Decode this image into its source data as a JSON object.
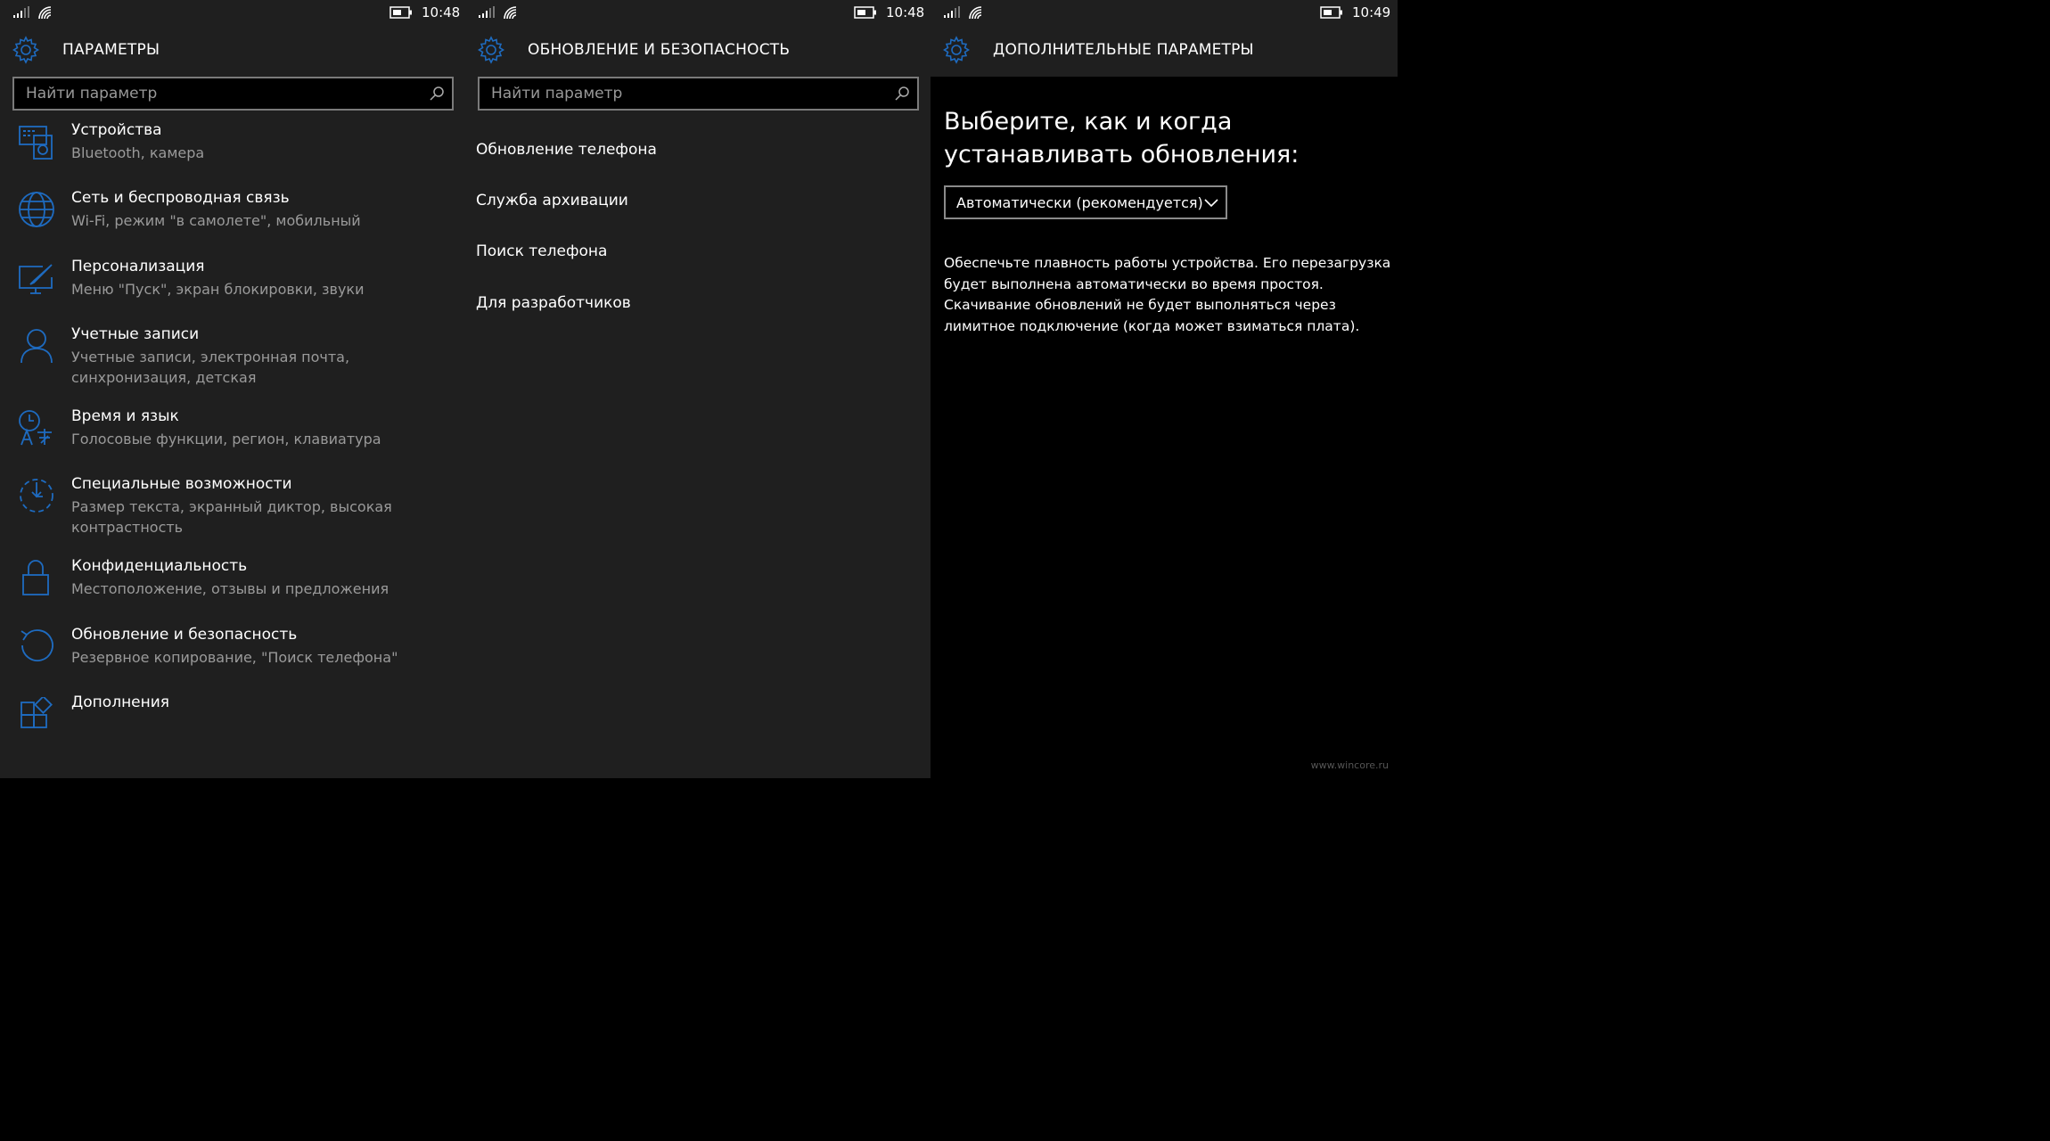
{
  "colors": {
    "accent": "#1e6bc0",
    "panel_bg": "#1f1f1f",
    "black": "#000000",
    "secondary_text": "#9a9a9a"
  },
  "status_bars": [
    {
      "time": "10:48"
    },
    {
      "time": "10:48"
    },
    {
      "time": "10:49"
    }
  ],
  "screen1": {
    "title": "ПАРАМЕТРЫ",
    "search_placeholder": "Найти параметр",
    "items": [
      {
        "icon": "devices-icon",
        "title": "Устройства",
        "subtitle": "Bluetooth, камера"
      },
      {
        "icon": "globe-icon",
        "title": "Сеть и беспроводная связь",
        "subtitle": "Wi-Fi, режим \"в самолете\", мобильный"
      },
      {
        "icon": "personalization-icon",
        "title": "Персонализация",
        "subtitle": "Меню \"Пуск\", экран блокировки, звуки"
      },
      {
        "icon": "person-icon",
        "title": "Учетные записи",
        "subtitle": "Учетные записи, электронная почта, синхронизация, детская"
      },
      {
        "icon": "time-language-icon",
        "title": "Время и язык",
        "subtitle": "Голосовые функции, регион, клавиатура"
      },
      {
        "icon": "accessibility-icon",
        "title": "Специальные возможности",
        "subtitle": "Размер текста, экранный диктор, высокая контрастность"
      },
      {
        "icon": "lock-icon",
        "title": "Конфиденциальность",
        "subtitle": "Местоположение, отзывы и предложения"
      },
      {
        "icon": "update-icon",
        "title": "Обновление и безопасность",
        "subtitle": "Резервное копирование, \"Поиск телефона\""
      },
      {
        "icon": "extras-icon",
        "title": "Дополнения",
        "subtitle": ""
      }
    ]
  },
  "screen2": {
    "title": "ОБНОВЛЕНИЕ И БЕЗОПАСНОСТЬ",
    "search_placeholder": "Найти параметр",
    "links": [
      "Обновление телефона",
      "Служба архивации",
      "Поиск телефона",
      "Для разработчиков"
    ]
  },
  "screen3": {
    "title": "ДОПОЛНИТЕЛЬНЫЕ ПАРАМЕТРЫ",
    "heading": "Выберите, как и когда устанавливать обновления:",
    "dropdown_value": "Автоматически (рекомендуется)",
    "description": "Обеспечьте плавность работы устройства. Его перезагрузка будет выполнена автоматически во время простоя. Скачивание обновлений не будет выполняться через лимитное подключение (когда может взиматься плата).",
    "watermark": "www.wincore.ru"
  }
}
